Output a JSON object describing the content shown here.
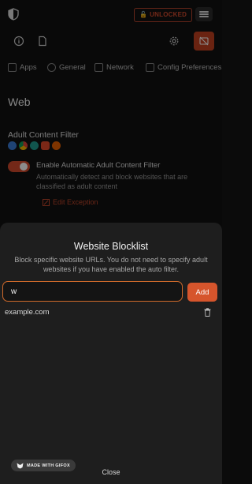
{
  "header": {
    "unlocked_label": "UNLOCKED"
  },
  "tabs": [
    {
      "label": "Apps",
      "icon": "grid-icon"
    },
    {
      "label": "General",
      "icon": "gear-icon"
    },
    {
      "label": "Network",
      "icon": "network-icon"
    },
    {
      "label": "Config Preferences",
      "icon": "database-icon"
    }
  ],
  "web": {
    "section_title": "Web",
    "filter_label": "Adult Content Filter",
    "auto_filter_label": "Enable Automatic Adult Content Filter",
    "auto_filter_desc": "Automatically detect and block websites that are classified as adult content",
    "exception_label": "Edit Exception"
  },
  "sheet": {
    "title": "Website Blocklist",
    "description": "Block specific website URLs. You do not need to specify adult websites if you have enabled the auto filter.",
    "input_value": "w",
    "add_label": "Add",
    "sites": [
      "example.com"
    ],
    "close_label": "Close"
  },
  "watermark": {
    "label": "MADE WITH GIFOX"
  },
  "colors": {
    "accent": "#d6552c",
    "sheet_bg": "#1e1e1e",
    "input_border": "#d06a2b"
  }
}
